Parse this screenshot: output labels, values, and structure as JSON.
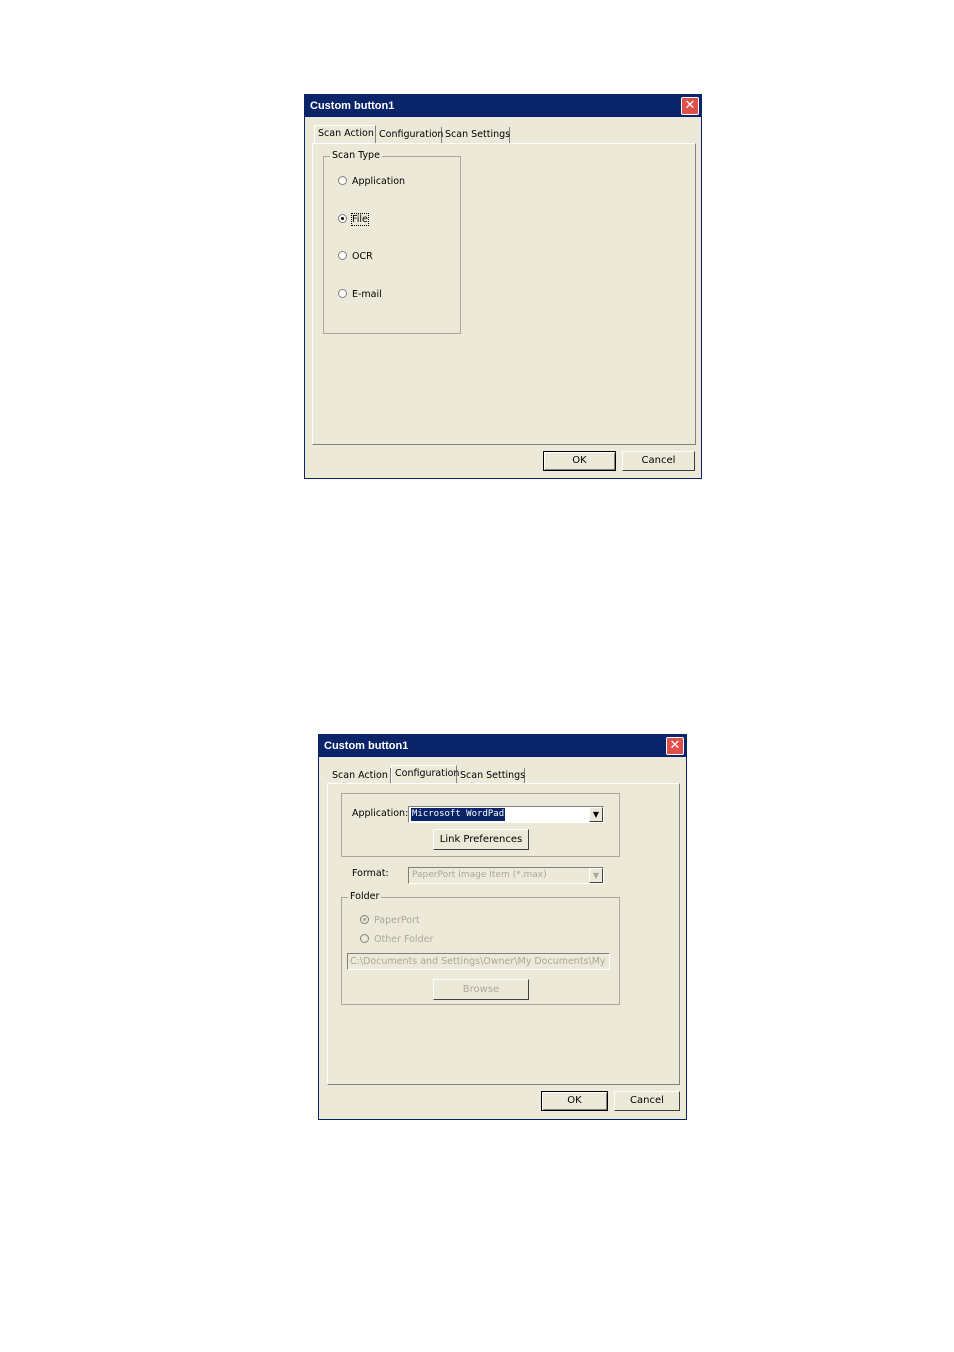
{
  "dialog1": {
    "title": "Custom button1",
    "tabs": [
      "Scan Action",
      "Configuration",
      "Scan Settings"
    ],
    "active_tab": "Scan Action",
    "group_label": "Scan Type",
    "radios": [
      {
        "label": "Application",
        "checked": false
      },
      {
        "label": "File",
        "checked": true
      },
      {
        "label": "OCR",
        "checked": false
      },
      {
        "label": "E-mail",
        "checked": false
      }
    ],
    "ok_label": "OK",
    "cancel_label": "Cancel"
  },
  "dialog2": {
    "title": "Custom button1",
    "tabs": [
      "Scan Action",
      "Configuration",
      "Scan Settings"
    ],
    "active_tab": "Configuration",
    "application_label": "Application:",
    "application_value": "Microsoft WordPad",
    "link_preferences_label": "Link Preferences",
    "format_label": "Format:",
    "format_value": "PaperPort Image Item (*.max)",
    "folder_group_label": "Folder",
    "folder_radios": [
      {
        "label": "PaperPort",
        "checked": true
      },
      {
        "label": "Other Folder",
        "checked": false
      }
    ],
    "folder_path": "C:\\Documents and Settings\\Owner\\My Documents\\My Pape",
    "browse_label": "Browse",
    "ok_label": "OK",
    "cancel_label": "Cancel"
  },
  "icons": {
    "close": "close-icon",
    "dropdown": "chevron-down-icon"
  }
}
